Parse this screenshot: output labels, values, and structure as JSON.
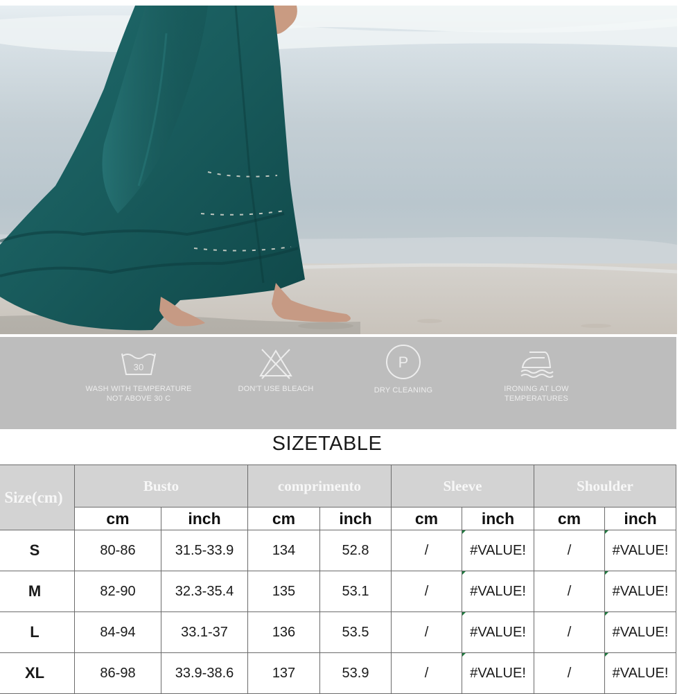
{
  "care_instructions": [
    {
      "icon": "wash-30-icon",
      "label_line1": "WASH WITH TEMPERATURE",
      "label_line2": "NOT ABOVE 30 C",
      "icon_text": "30"
    },
    {
      "icon": "no-bleach-icon",
      "label_line1": "DON'T USE BLEACH",
      "label_line2": ""
    },
    {
      "icon": "dry-clean-icon",
      "label_line1": "DRY CLEANING",
      "label_line2": "",
      "icon_text": "P"
    },
    {
      "icon": "iron-low-icon",
      "label_line1": "IRONING AT LOW",
      "label_line2": "TEMPERATURES"
    }
  ],
  "size_table": {
    "title": "SIZETABLE",
    "size_header": "Size(cm)",
    "groups": [
      "Busto",
      "comprimento",
      "Sleeve",
      "Shoulder"
    ],
    "units": [
      "cm",
      "inch",
      "cm",
      "inch",
      "cm",
      "inch",
      "cm",
      "inch"
    ],
    "rows": [
      {
        "size": "S",
        "cells": [
          "80-86",
          "31.5-33.9",
          "134",
          "52.8",
          "/",
          "#VALUE!",
          "/",
          "#VALUE!"
        ]
      },
      {
        "size": "M",
        "cells": [
          "82-90",
          "32.3-35.4",
          "135",
          "53.1",
          "/",
          "#VALUE!",
          "/",
          "#VALUE!"
        ]
      },
      {
        "size": "L",
        "cells": [
          "84-94",
          "33.1-37",
          "136",
          "53.5",
          "/",
          "#VALUE!",
          "/",
          "#VALUE!"
        ]
      },
      {
        "size": "XL",
        "cells": [
          "86-98",
          "33.9-38.6",
          "137",
          "53.9",
          "/",
          "#VALUE!",
          "/",
          "#VALUE!"
        ]
      }
    ]
  },
  "colors": {
    "dress": "#1d5f5f",
    "care_band": "#bdbdbd",
    "table_header": "#d3d3d3",
    "table_border": "#6b6b6b"
  }
}
